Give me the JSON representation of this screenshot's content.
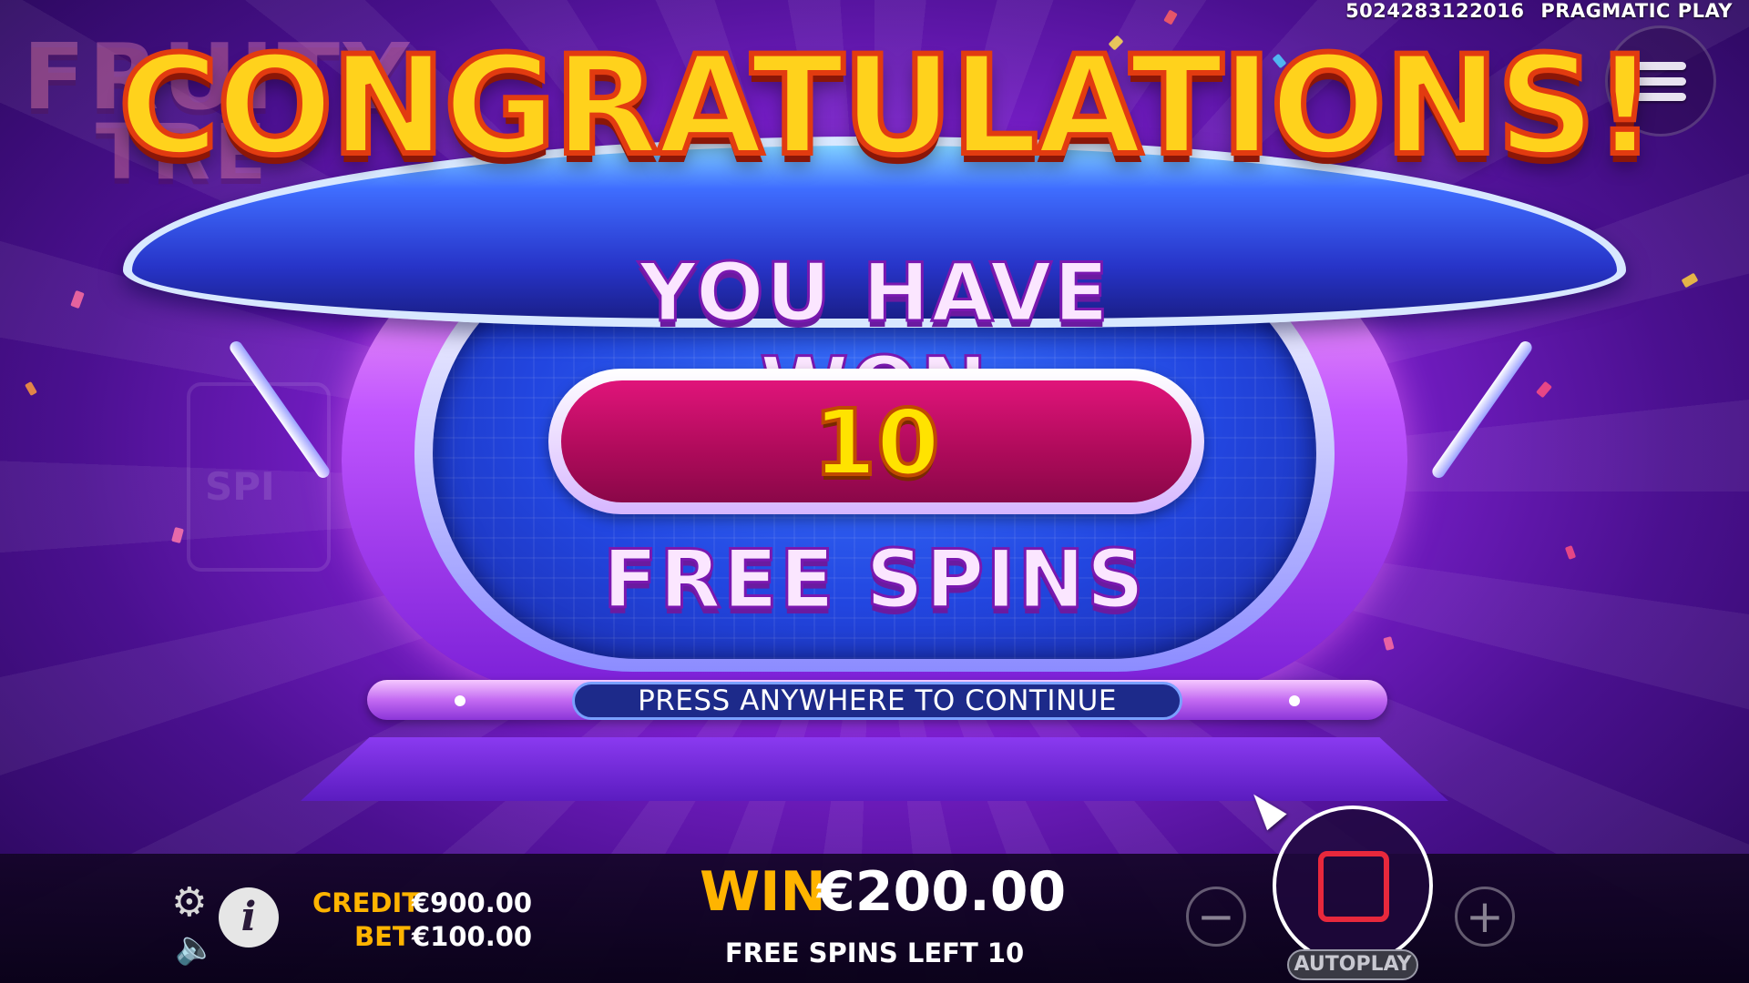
{
  "header": {
    "session_id": "5024283122016",
    "provider": "PRAGMATIC PLAY"
  },
  "logo": {
    "line1": "FRUITY",
    "line2": "TRE"
  },
  "background_panel": {
    "text": "SPI"
  },
  "popup": {
    "title": "CONGRATULATIONS!",
    "subtitle": "YOU HAVE WON",
    "count": "10",
    "count_label": "FREE SPINS",
    "continue_text": "PRESS ANYWHERE TO CONTINUE"
  },
  "bottom_bar": {
    "credit_label": "CREDIT",
    "credit_value": "€900.00",
    "bet_label": "BET",
    "bet_value": "€100.00",
    "win_label": "WIN",
    "win_value": "€200.00",
    "free_spins_left": "FREE SPINS LEFT 10",
    "minus_symbol": "−",
    "plus_symbol": "+",
    "autoplay_label": "AUTOPLAY"
  },
  "icons": {
    "menu": "hamburger-icon",
    "settings": "gear-icon",
    "sound": "speaker-icon",
    "info": "info-icon",
    "spin": "stop-icon"
  },
  "colors": {
    "title_fill": "#ffd21c",
    "title_stroke": "#e23b10",
    "count_pill": "#c30d69",
    "accent_label": "#ffb400",
    "stop_icon": "#e8283c"
  }
}
